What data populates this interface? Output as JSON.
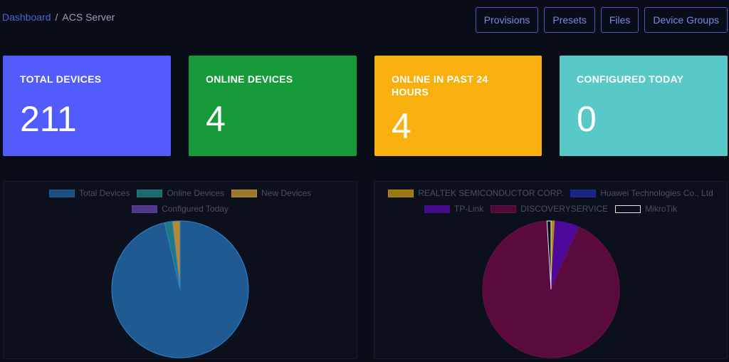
{
  "breadcrumb": {
    "parent": "Dashboard",
    "separator": "/",
    "current": "ACS Server"
  },
  "nav": {
    "provisions": "Provisions",
    "presets": "Presets",
    "files": "Files",
    "device_groups": "Device Groups"
  },
  "stats": [
    {
      "title": "TOTAL DEVICES",
      "value": "211",
      "color": "#525cfd"
    },
    {
      "title": "ONLINE DEVICES",
      "value": "4",
      "color": "#179a3a"
    },
    {
      "title": "ONLINE IN PAST 24 HOURS",
      "value": "4",
      "color": "#f8b00e"
    },
    {
      "title": "CONFIGURED TODAY",
      "value": "0",
      "color": "#58c9c7"
    }
  ],
  "chart_data": [
    {
      "type": "pie",
      "categories": [
        "Total Devices",
        "Online Devices",
        "New Devices",
        "Configured Today"
      ],
      "values": [
        211,
        4,
        4,
        0
      ],
      "colors": [
        "#1f5b92",
        "#1f7a80",
        "#b58a32",
        "#5a3f9a"
      ],
      "legend": "top"
    },
    {
      "type": "pie",
      "categories": [
        "REALTEK SEMICONDUCTOR CORP.",
        "Huawei Technologies Co., Ltd",
        "TP-Link",
        "DISCOVERYSERVICE",
        "MikroTik"
      ],
      "values": [
        2,
        0,
        12,
        195,
        2
      ],
      "colors": [
        "#b58a10",
        "#1c2896",
        "#4d0a9a",
        "#5a0a3c",
        "#0b101c"
      ],
      "borders": [
        "#b58a10",
        "#1c2896",
        "#4d0a9a",
        "#6d1048",
        "#e5e7ee"
      ],
      "legend": "top"
    }
  ]
}
